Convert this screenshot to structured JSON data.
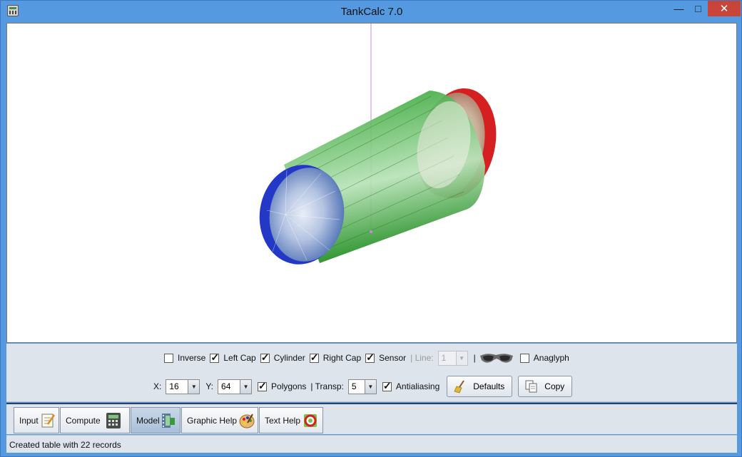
{
  "window": {
    "title": "TankCalc 7.0",
    "minimize_label": "—",
    "maximize_label": "□",
    "close_label": "✕"
  },
  "canvas": {
    "colors": {
      "cylinder": "#2aa02a",
      "left_cap": "#2438c8",
      "right_cap": "#d42020",
      "sensor": "#c58bd6"
    }
  },
  "controls": {
    "inverse": {
      "label": "Inverse",
      "checked": false
    },
    "left_cap": {
      "label": "Left Cap",
      "checked": true
    },
    "cylinder": {
      "label": "Cylinder",
      "checked": true
    },
    "right_cap": {
      "label": "Right Cap",
      "checked": true
    },
    "sensor": {
      "label": "Sensor",
      "checked": true
    },
    "line_label": "| Line:",
    "line_value": "1",
    "divider": "|",
    "anaglyph": {
      "label": "Anaglyph",
      "checked": false
    },
    "x_label": "X:",
    "x_value": "16",
    "y_label": "Y:",
    "y_value": "64",
    "polygons": {
      "label": "Polygons",
      "checked": true
    },
    "transp_label": "| Transp:",
    "transp_value": "5",
    "antialiasing": {
      "label": "Antialiasing",
      "checked": true
    },
    "defaults_button": "Defaults",
    "copy_button": "Copy"
  },
  "tabs": [
    {
      "label": "Input",
      "icon": "notepad-pencil-icon",
      "active": false
    },
    {
      "label": "Compute",
      "icon": "calculator-icon",
      "active": false
    },
    {
      "label": "Model",
      "icon": "film-strip-icon",
      "active": true
    },
    {
      "label": "Graphic Help",
      "icon": "paint-palette-icon",
      "active": false
    },
    {
      "label": "Text Help",
      "icon": "lifebuoy-icon",
      "active": false
    }
  ],
  "status": "Created table with 22 records"
}
